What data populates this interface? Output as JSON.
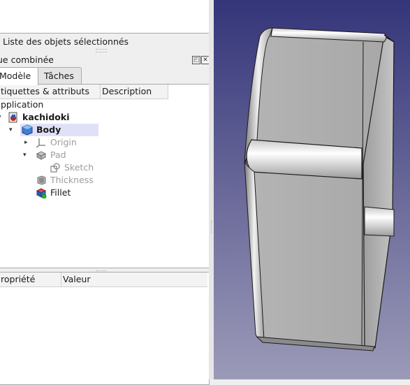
{
  "selection_panel": {
    "label": "Liste des objets sélectionnés"
  },
  "combo_view": {
    "title": "ue combinée",
    "tabs": [
      {
        "label": "Modèle",
        "active": true
      },
      {
        "label": "Tâches",
        "active": false
      }
    ]
  },
  "tree": {
    "columns": [
      "tiquettes & attributs",
      "Description"
    ],
    "root": "pplication",
    "items": [
      {
        "label": "kachidoki",
        "bold": true,
        "icon": "document-icon"
      },
      {
        "label": "Body",
        "bold": true,
        "icon": "body-icon",
        "selected": true
      },
      {
        "label": "Origin",
        "dimmed": true,
        "icon": "origin-axes-icon"
      },
      {
        "label": "Pad",
        "dimmed": true,
        "icon": "pad-icon"
      },
      {
        "label": "Sketch",
        "dimmed": true,
        "icon": "sketch-icon"
      },
      {
        "label": "Thickness",
        "dimmed": true,
        "icon": "thickness-icon"
      },
      {
        "label": "Fillet",
        "dimmed": false,
        "icon": "fillet-icon"
      }
    ]
  },
  "property_view": {
    "columns": [
      "ropriété",
      "Valeur"
    ]
  },
  "colors": {
    "selection_highlight": "#e0e0f8",
    "viewport_top": "#34357a",
    "viewport_bottom": "#9b9ab8"
  }
}
